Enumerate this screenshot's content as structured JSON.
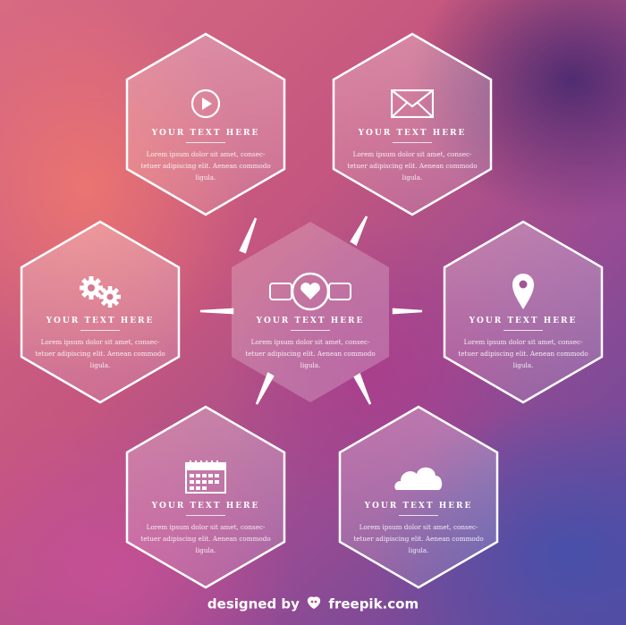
{
  "cards": [
    {
      "id": "play",
      "title": "YOUR TEXT HERE",
      "body": "Lorem ipsum dolor sit amet, consec-tetuer adipiscing elit. Aenean commodo ligula.",
      "icon": "play-icon"
    },
    {
      "id": "mail",
      "title": "YOUR TEXT HERE",
      "body": "Lorem ipsum dolor sit amet, consec-tetuer adipiscing elit. Aenean commodo ligula.",
      "icon": "envelope-icon"
    },
    {
      "id": "gears",
      "title": "YOUR TEXT HERE",
      "body": "Lorem ipsum dolor sit amet, consec-tetuer adipiscing elit. Aenean commodo ligula.",
      "icon": "gears-icon"
    },
    {
      "id": "watch",
      "title": "YOUR TEXT HERE",
      "body": "Lorem ipsum dolor sit amet, consec-tetuer adipiscing elit. Aenean commodo ligula.",
      "icon": "heart-watch-icon"
    },
    {
      "id": "pin",
      "title": "YOUR TEXT HERE",
      "body": "Lorem ipsum dolor sit amet, consec-tetuer adipiscing elit. Aenean commodo ligula.",
      "icon": "location-pin-icon"
    },
    {
      "id": "calendar",
      "title": "YOUR TEXT HERE",
      "body": "Lorem ipsum dolor sit amet, consec-tetuer adipiscing elit. Aenean commodo ligula.",
      "icon": "calendar-icon"
    },
    {
      "id": "cloud",
      "title": "YOUR TEXT HERE",
      "body": "Lorem ipsum dolor sit amet, consec-tetuer adipiscing elit. Aenean commodo ligula.",
      "icon": "cloud-icon"
    }
  ],
  "footer": {
    "designed_by": "designed by",
    "brand": "freepik.com",
    "logo_icon": "freepik-logo-icon"
  }
}
